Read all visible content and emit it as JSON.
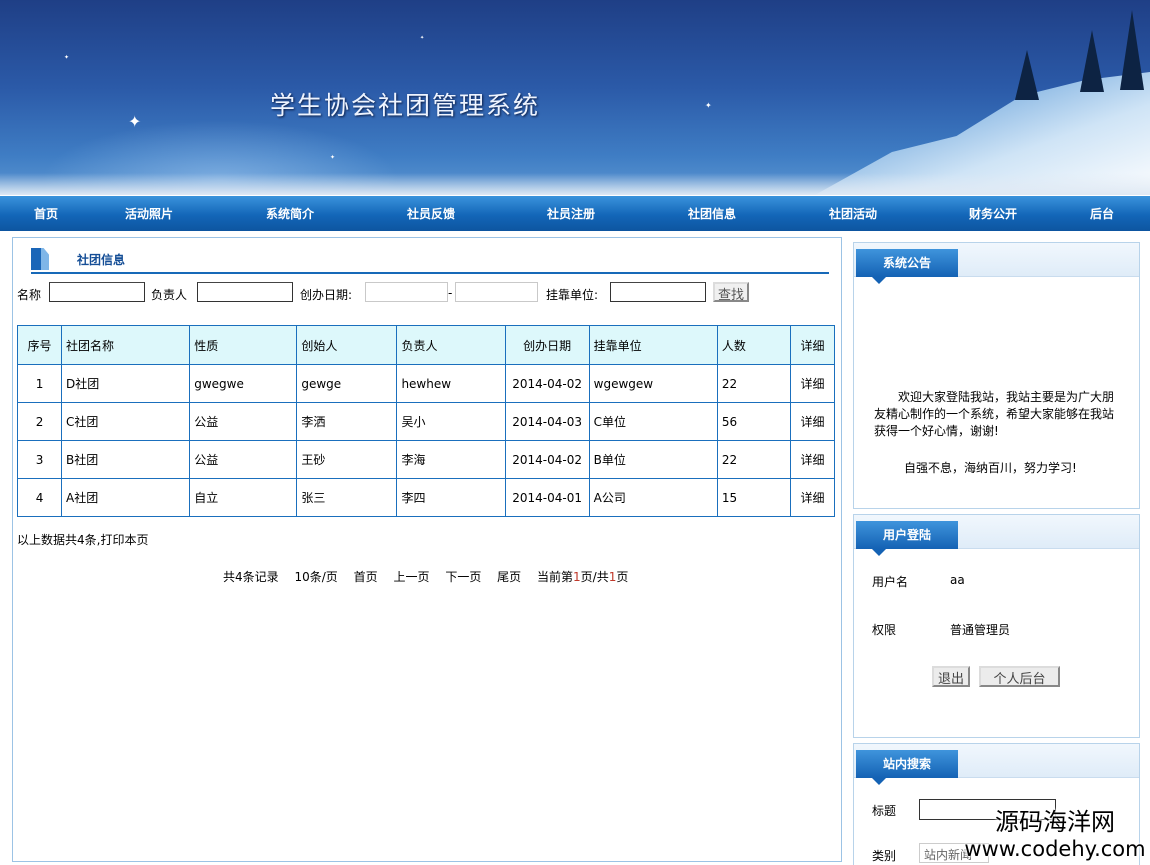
{
  "header": {
    "title": "学生协会社团管理系统"
  },
  "nav": {
    "items": [
      "首页",
      "活动照片",
      "系统简介",
      "社员反馈",
      "社员注册",
      "社团信息",
      "社团活动",
      "财务公开",
      "后台"
    ]
  },
  "main": {
    "section_title": "社团信息",
    "filter": {
      "name_label": "名称",
      "manager_label": "负责人",
      "date_label": "创办日期:",
      "date_sep": "-",
      "unit_label": "挂靠单位:",
      "search_button": "查找",
      "name_value": "",
      "manager_value": "",
      "date_from_value": "",
      "date_to_value": "",
      "unit_value": ""
    },
    "table": {
      "headers": [
        "序号",
        "社团名称",
        "性质",
        "创始人",
        "负责人",
        "创办日期",
        "挂靠单位",
        "人数",
        "详细"
      ],
      "rows": [
        [
          "1",
          "D社团",
          "gwegwe",
          "gewge",
          "hewhew",
          "2014-04-02",
          "wgewgew",
          "22",
          "详细"
        ],
        [
          "2",
          "C社团",
          "公益",
          "李洒",
          "吴小",
          "2014-04-03",
          "C单位",
          "56",
          "详细"
        ],
        [
          "3",
          "B社团",
          "公益",
          "王砂",
          "李海",
          "2014-04-02",
          "B单位",
          "22",
          "详细"
        ],
        [
          "4",
          "A社团",
          "自立",
          "张三",
          "李四",
          "2014-04-01",
          "A公司",
          "15",
          "详细"
        ]
      ]
    },
    "summary": "以上数据共4条,打印本页",
    "pager": {
      "total": "共4条记录",
      "per_page": "10条/页",
      "first": "首页",
      "prev": "上一页",
      "next": "下一页",
      "last": "尾页",
      "current_prefix": "当前第",
      "current_page": "1",
      "current_mid": "页/共",
      "total_pages": "1",
      "current_suffix": "页"
    }
  },
  "sidebar": {
    "notice": {
      "title": "系统公告",
      "text": "欢迎大家登陆我站，我站主要是为广大朋友精心制作的一个系统，希望大家能够在我站获得一个好心情，谢谢!",
      "motto": "自强不息，海纳百川，努力学习!"
    },
    "login": {
      "title": "用户登陆",
      "user_label": "用户名",
      "user_value": "aa",
      "role_label": "权限",
      "role_value": "普通管理员",
      "logout_button": "退出",
      "profile_button": "个人后台"
    },
    "search": {
      "title": "站内搜索",
      "title_label": "标题",
      "title_value": "",
      "type_label": "类别",
      "type_value": "站内新闻"
    }
  },
  "watermark": {
    "cn": "源码海洋网",
    "url": "www.codehy.com"
  },
  "colors": {
    "nav": "#1366b8",
    "table_header": "#ddf8fb",
    "border": "#1a6fbd"
  }
}
